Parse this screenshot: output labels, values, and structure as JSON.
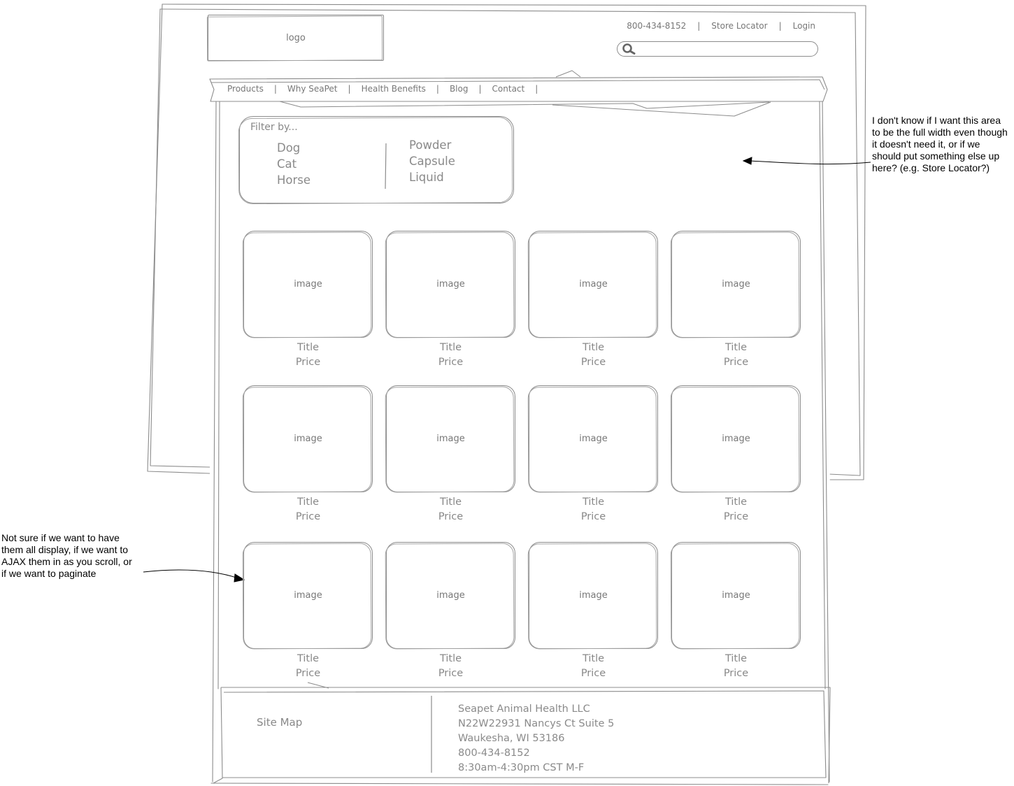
{
  "header": {
    "logo_label": "logo",
    "phone": "800-434-8152",
    "separator": "|",
    "store_locator": "Store Locator",
    "login": "Login"
  },
  "nav": {
    "items": [
      {
        "label": "Products"
      },
      {
        "label": "Why SeaPet"
      },
      {
        "label": "Health Benefits"
      },
      {
        "label": "Blog"
      },
      {
        "label": "Contact"
      }
    ],
    "separator": "|"
  },
  "filter": {
    "heading": "Filter by...",
    "animals": [
      "Dog",
      "Cat",
      "Horse"
    ],
    "forms": [
      "Powder",
      "Capsule",
      "Liquid"
    ]
  },
  "products": {
    "items": [
      {
        "image_label": "image",
        "title": "Title",
        "price": "Price"
      },
      {
        "image_label": "image",
        "title": "Title",
        "price": "Price"
      },
      {
        "image_label": "image",
        "title": "Title",
        "price": "Price"
      },
      {
        "image_label": "image",
        "title": "Title",
        "price": "Price"
      },
      {
        "image_label": "image",
        "title": "Title",
        "price": "Price"
      },
      {
        "image_label": "image",
        "title": "Title",
        "price": "Price"
      },
      {
        "image_label": "image",
        "title": "Title",
        "price": "Price"
      },
      {
        "image_label": "image",
        "title": "Title",
        "price": "Price"
      },
      {
        "image_label": "image",
        "title": "Title",
        "price": "Price"
      },
      {
        "image_label": "image",
        "title": "Title",
        "price": "Price"
      },
      {
        "image_label": "image",
        "title": "Title",
        "price": "Price"
      },
      {
        "image_label": "image",
        "title": "Title",
        "price": "Price"
      }
    ]
  },
  "footer": {
    "site_map": "Site Map",
    "address_lines": [
      "Seapet Animal Health LLC",
      "N22W22931 Nancys Ct Suite 5",
      "Waukesha, WI 53186",
      "800-434-8152",
      "8:30am-4:30pm CST M-F"
    ]
  },
  "annotations": {
    "filter_note": "I don't know if I want this area to be the full width even though it doesn't need it, or if we should put something else up here? (e.g. Store Locator?)",
    "grid_note": "Not sure if we want to have them all display, if we want to AJAX them in as you scroll, or if we want to paginate"
  },
  "colors": {
    "sketch_line": "#8c8c8c",
    "sketch_text": "#7a7a7a",
    "annotation_text": "#000000",
    "search_icon": "#666666"
  }
}
